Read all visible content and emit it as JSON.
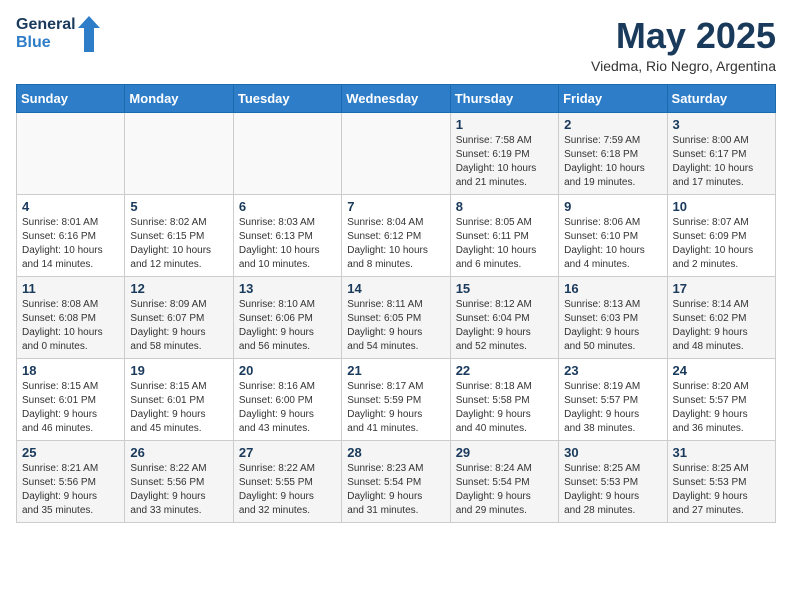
{
  "header": {
    "logo_line1": "General",
    "logo_line2": "Blue",
    "month_year": "May 2025",
    "location": "Viedma, Rio Negro, Argentina"
  },
  "days_of_week": [
    "Sunday",
    "Monday",
    "Tuesday",
    "Wednesday",
    "Thursday",
    "Friday",
    "Saturday"
  ],
  "weeks": [
    [
      {
        "day": "",
        "info": ""
      },
      {
        "day": "",
        "info": ""
      },
      {
        "day": "",
        "info": ""
      },
      {
        "day": "",
        "info": ""
      },
      {
        "day": "1",
        "info": "Sunrise: 7:58 AM\nSunset: 6:19 PM\nDaylight: 10 hours\nand 21 minutes."
      },
      {
        "day": "2",
        "info": "Sunrise: 7:59 AM\nSunset: 6:18 PM\nDaylight: 10 hours\nand 19 minutes."
      },
      {
        "day": "3",
        "info": "Sunrise: 8:00 AM\nSunset: 6:17 PM\nDaylight: 10 hours\nand 17 minutes."
      }
    ],
    [
      {
        "day": "4",
        "info": "Sunrise: 8:01 AM\nSunset: 6:16 PM\nDaylight: 10 hours\nand 14 minutes."
      },
      {
        "day": "5",
        "info": "Sunrise: 8:02 AM\nSunset: 6:15 PM\nDaylight: 10 hours\nand 12 minutes."
      },
      {
        "day": "6",
        "info": "Sunrise: 8:03 AM\nSunset: 6:13 PM\nDaylight: 10 hours\nand 10 minutes."
      },
      {
        "day": "7",
        "info": "Sunrise: 8:04 AM\nSunset: 6:12 PM\nDaylight: 10 hours\nand 8 minutes."
      },
      {
        "day": "8",
        "info": "Sunrise: 8:05 AM\nSunset: 6:11 PM\nDaylight: 10 hours\nand 6 minutes."
      },
      {
        "day": "9",
        "info": "Sunrise: 8:06 AM\nSunset: 6:10 PM\nDaylight: 10 hours\nand 4 minutes."
      },
      {
        "day": "10",
        "info": "Sunrise: 8:07 AM\nSunset: 6:09 PM\nDaylight: 10 hours\nand 2 minutes."
      }
    ],
    [
      {
        "day": "11",
        "info": "Sunrise: 8:08 AM\nSunset: 6:08 PM\nDaylight: 10 hours\nand 0 minutes."
      },
      {
        "day": "12",
        "info": "Sunrise: 8:09 AM\nSunset: 6:07 PM\nDaylight: 9 hours\nand 58 minutes."
      },
      {
        "day": "13",
        "info": "Sunrise: 8:10 AM\nSunset: 6:06 PM\nDaylight: 9 hours\nand 56 minutes."
      },
      {
        "day": "14",
        "info": "Sunrise: 8:11 AM\nSunset: 6:05 PM\nDaylight: 9 hours\nand 54 minutes."
      },
      {
        "day": "15",
        "info": "Sunrise: 8:12 AM\nSunset: 6:04 PM\nDaylight: 9 hours\nand 52 minutes."
      },
      {
        "day": "16",
        "info": "Sunrise: 8:13 AM\nSunset: 6:03 PM\nDaylight: 9 hours\nand 50 minutes."
      },
      {
        "day": "17",
        "info": "Sunrise: 8:14 AM\nSunset: 6:02 PM\nDaylight: 9 hours\nand 48 minutes."
      }
    ],
    [
      {
        "day": "18",
        "info": "Sunrise: 8:15 AM\nSunset: 6:01 PM\nDaylight: 9 hours\nand 46 minutes."
      },
      {
        "day": "19",
        "info": "Sunrise: 8:15 AM\nSunset: 6:01 PM\nDaylight: 9 hours\nand 45 minutes."
      },
      {
        "day": "20",
        "info": "Sunrise: 8:16 AM\nSunset: 6:00 PM\nDaylight: 9 hours\nand 43 minutes."
      },
      {
        "day": "21",
        "info": "Sunrise: 8:17 AM\nSunset: 5:59 PM\nDaylight: 9 hours\nand 41 minutes."
      },
      {
        "day": "22",
        "info": "Sunrise: 8:18 AM\nSunset: 5:58 PM\nDaylight: 9 hours\nand 40 minutes."
      },
      {
        "day": "23",
        "info": "Sunrise: 8:19 AM\nSunset: 5:57 PM\nDaylight: 9 hours\nand 38 minutes."
      },
      {
        "day": "24",
        "info": "Sunrise: 8:20 AM\nSunset: 5:57 PM\nDaylight: 9 hours\nand 36 minutes."
      }
    ],
    [
      {
        "day": "25",
        "info": "Sunrise: 8:21 AM\nSunset: 5:56 PM\nDaylight: 9 hours\nand 35 minutes."
      },
      {
        "day": "26",
        "info": "Sunrise: 8:22 AM\nSunset: 5:56 PM\nDaylight: 9 hours\nand 33 minutes."
      },
      {
        "day": "27",
        "info": "Sunrise: 8:22 AM\nSunset: 5:55 PM\nDaylight: 9 hours\nand 32 minutes."
      },
      {
        "day": "28",
        "info": "Sunrise: 8:23 AM\nSunset: 5:54 PM\nDaylight: 9 hours\nand 31 minutes."
      },
      {
        "day": "29",
        "info": "Sunrise: 8:24 AM\nSunset: 5:54 PM\nDaylight: 9 hours\nand 29 minutes."
      },
      {
        "day": "30",
        "info": "Sunrise: 8:25 AM\nSunset: 5:53 PM\nDaylight: 9 hours\nand 28 minutes."
      },
      {
        "day": "31",
        "info": "Sunrise: 8:25 AM\nSunset: 5:53 PM\nDaylight: 9 hours\nand 27 minutes."
      }
    ]
  ]
}
